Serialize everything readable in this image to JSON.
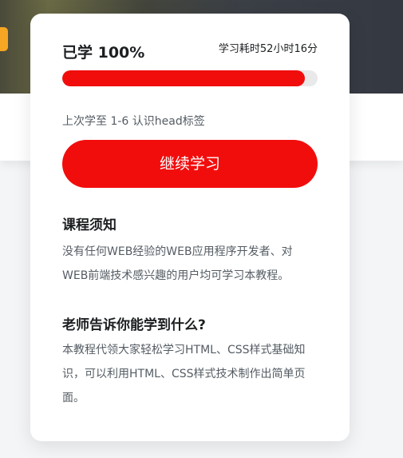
{
  "colors": {
    "accent": "#f20d0d",
    "track": "#e9e9e9",
    "title_text": "#1c1f21",
    "body_text": "#545c63"
  },
  "progress": {
    "title": "已学 100%",
    "time_spent": "学习耗时52小时16分",
    "bar_fill_fraction": 0.95
  },
  "last_study": "上次学至 1-6 认识head标签",
  "continue_button": "继续学习",
  "sections": [
    {
      "heading": "课程须知",
      "text": "没有任何WEB经验的WEB应用程序开发者、对WEB前端技术感兴趣的用户均可学习本教程。"
    },
    {
      "heading": "老师告诉你能学到什么?",
      "text": "本教程代领大家轻松学习HTML、CSS样式基础知识，可以利用HTML、CSS样式技术制作出简单页面。"
    }
  ]
}
